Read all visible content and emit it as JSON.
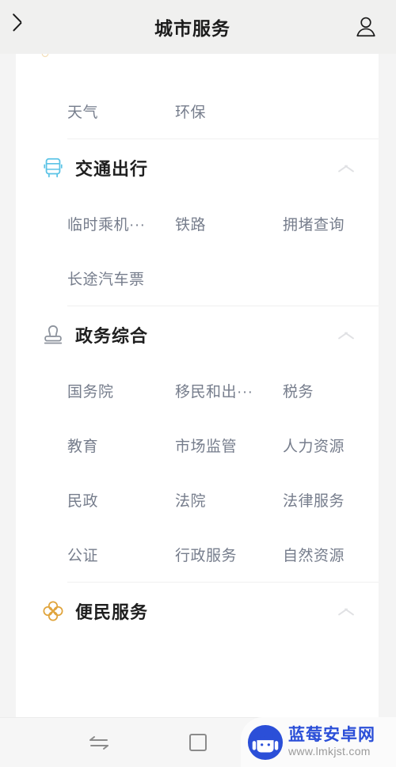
{
  "header": {
    "title": "城市服务",
    "back_icon": "chevron-left-icon",
    "profile_icon": "person-icon"
  },
  "sections": [
    {
      "id": "partial-top",
      "title": "",
      "icon": "flower-icon",
      "collapsed_label": "",
      "items": [
        "天气",
        "环保"
      ]
    },
    {
      "id": "transport",
      "title": "交通出行",
      "icon": "bus-icon",
      "icon_color": "#5ac3e6",
      "toggle_icon": "chevron-up-icon",
      "items": [
        "临时乘机···",
        "铁路",
        "拥堵查询",
        "长途汽车票"
      ]
    },
    {
      "id": "government",
      "title": "政务综合",
      "icon": "stamp-icon",
      "icon_color": "#8d939d",
      "toggle_icon": "chevron-up-icon",
      "items": [
        "国务院",
        "移民和出···",
        "税务",
        "教育",
        "市场监管",
        "人力资源",
        "民政",
        "法院",
        "法律服务",
        "公证",
        "行政服务",
        "自然资源"
      ]
    },
    {
      "id": "convenience",
      "title": "便民服务",
      "icon": "flower-icon",
      "icon_color": "#e0a43c",
      "toggle_icon": "chevron-up-icon",
      "items": []
    }
  ],
  "navbar": {
    "buttons": [
      {
        "name": "back-nav",
        "icon": "swap-arrows-icon"
      },
      {
        "name": "recents-nav",
        "icon": "square-icon"
      }
    ]
  },
  "watermark": {
    "logo_icon": "android-robot-icon",
    "site_name": "蓝莓安卓网",
    "site_url": "www.lmkjst.com",
    "name_color": "#2b4fd8"
  }
}
